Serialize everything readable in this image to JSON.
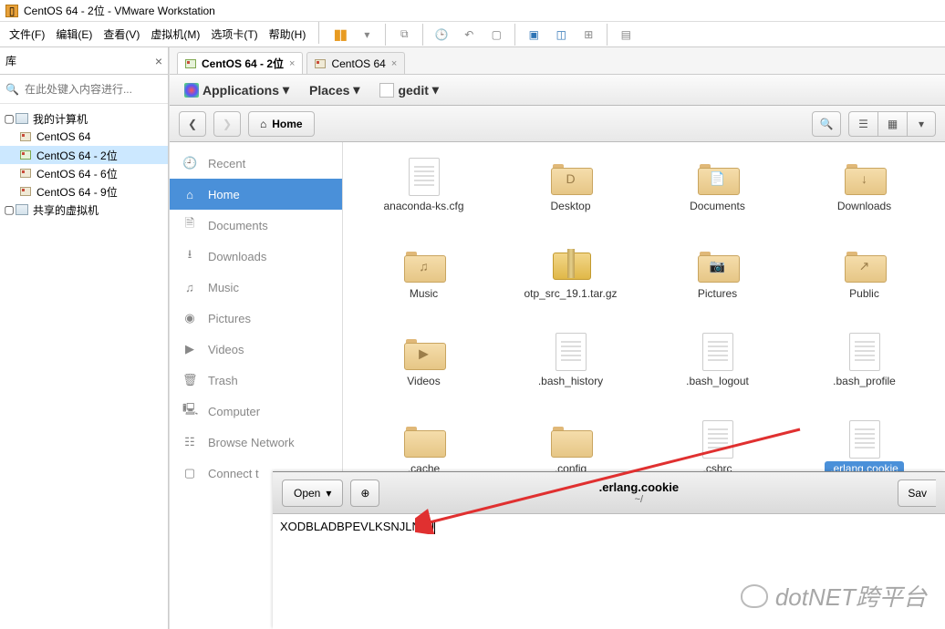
{
  "window": {
    "title": "CentOS 64 - 2位 - VMware Workstation"
  },
  "menu": {
    "file": "文件(F)",
    "edit": "编辑(E)",
    "view": "查看(V)",
    "vm": "虚拟机(M)",
    "tabs": "选项卡(T)",
    "help": "帮助(H)"
  },
  "sidebar": {
    "head": "库",
    "search_placeholder": "在此处键入内容进行...",
    "root": "我的计算机",
    "vms": [
      "CentOS 64",
      "CentOS 64 - 2位",
      "CentOS 64 - 6位",
      "CentOS 64 - 9位"
    ],
    "shared": "共享的虚拟机"
  },
  "tabs": {
    "active": "CentOS 64 - 2位",
    "inactive": "CentOS 64"
  },
  "gnome": {
    "applications": "Applications",
    "places": "Places",
    "gedit": "gedit"
  },
  "fm": {
    "home_label": "Home",
    "places": {
      "recent": "Recent",
      "home": "Home",
      "documents": "Documents",
      "downloads": "Downloads",
      "music": "Music",
      "pictures": "Pictures",
      "videos": "Videos",
      "trash": "Trash",
      "computer": "Computer",
      "browse": "Browse Network",
      "connect": "Connect t"
    },
    "files": [
      {
        "name": "anaconda-ks.cfg",
        "type": "doc"
      },
      {
        "name": "Desktop",
        "type": "folder",
        "mark": "D"
      },
      {
        "name": "Documents",
        "type": "folder",
        "mark": "📄"
      },
      {
        "name": "Downloads",
        "type": "folder",
        "mark": "↓"
      },
      {
        "name": "Music",
        "type": "folder",
        "mark": "♫"
      },
      {
        "name": "otp_src_19.1.tar.gz",
        "type": "tar"
      },
      {
        "name": "Pictures",
        "type": "folder",
        "mark": "📷"
      },
      {
        "name": "Public",
        "type": "folder",
        "mark": "↗"
      },
      {
        "name": "Videos",
        "type": "folder",
        "mark": "▶"
      },
      {
        "name": ".bash_history",
        "type": "doc"
      },
      {
        "name": ".bash_logout",
        "type": "doc"
      },
      {
        "name": ".bash_profile",
        "type": "doc"
      },
      {
        "name": ".cache",
        "type": "folder"
      },
      {
        "name": ".config",
        "type": "folder"
      },
      {
        "name": ".cshrc",
        "type": "doc"
      },
      {
        "name": ".erlang.cookie",
        "type": "doc",
        "selected": true
      }
    ]
  },
  "gedit": {
    "open": "Open",
    "filename": ".erlang.cookie",
    "path": "~/",
    "save": "Sav",
    "content": "XODBLADBPEVLKSNJLNAJ"
  },
  "watermark": "dotNET跨平台"
}
